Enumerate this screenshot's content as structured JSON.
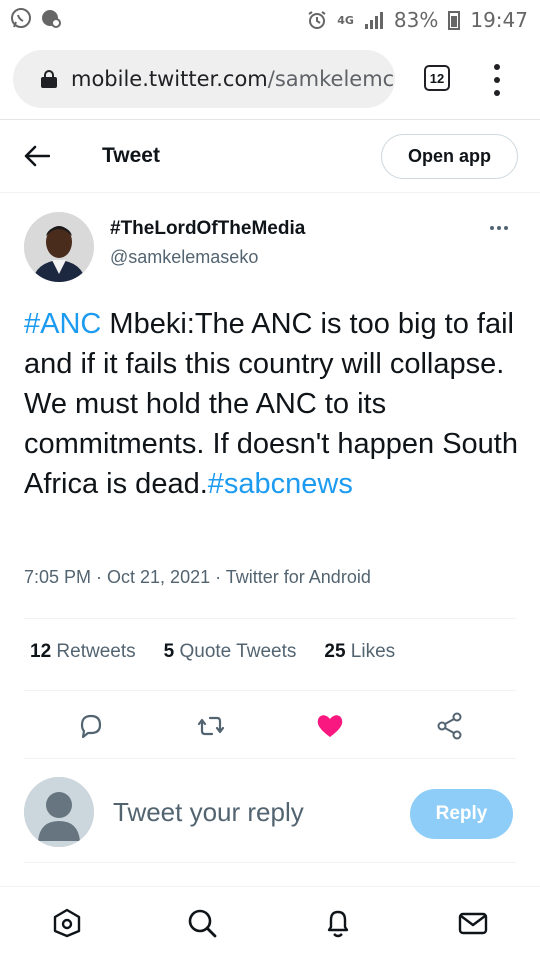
{
  "status_bar": {
    "battery": "83%",
    "time": "19:47",
    "network": "4G"
  },
  "browser": {
    "url_host": "mobile.twitter.com",
    "url_path": "/samkelemc",
    "tab_count": "12",
    "icons": [
      "lock-icon",
      "tabs-icon",
      "overflow-menu-icon"
    ]
  },
  "header": {
    "title": "Tweet",
    "open_app_label": "Open app"
  },
  "tweet": {
    "display_name": "#TheLordOfTheMedia",
    "handle": "@samkelemaseko",
    "text_parts": [
      {
        "type": "tag",
        "text": "#ANC"
      },
      {
        "type": "text",
        "text": " Mbeki:The ANC is too big to fail and if it  fails this country will collapse. We must hold the ANC to its commitments. If doesn't happen South Africa is dead."
      },
      {
        "type": "tag",
        "text": "#sabcnews"
      }
    ],
    "meta": "7:05 PM · Oct 21, 2021 · Twitter for Android",
    "stats": {
      "retweets_count": "12",
      "retweets_label": "Retweets",
      "quotes_count": "5",
      "quotes_label": "Quote Tweets",
      "likes_count": "25",
      "likes_label": "Likes"
    },
    "liked": true
  },
  "reply": {
    "placeholder": "Tweet your reply",
    "button_label": "Reply"
  },
  "colors": {
    "accent": "#1d9bf0",
    "like": "#f91880",
    "reply_disabled": "#8ecdf8",
    "secondary_text": "#536471"
  }
}
